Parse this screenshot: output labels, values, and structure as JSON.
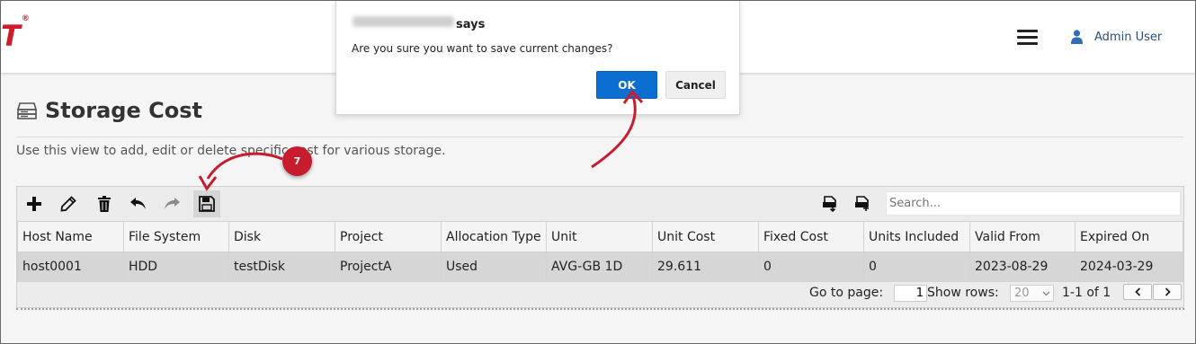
{
  "header": {
    "logo_text": "T",
    "logo_mark": "®",
    "menu_icon": "hamburger-icon",
    "user_icon": "user-icon",
    "user_name": "Admin User"
  },
  "page": {
    "title": "Storage Cost",
    "title_icon": "storage-server-icon",
    "description": "Use this view to add, edit or delete specific cost for various storage."
  },
  "toolbar": {
    "buttons": [
      "add-icon",
      "edit-pencil-icon",
      "delete-trash-icon",
      "undo-icon",
      "redo-icon",
      "save-icon"
    ],
    "export_buttons": [
      "export-pdf-icon",
      "export-all-pdf-icon"
    ],
    "search_placeholder": "Search..."
  },
  "table": {
    "columns": [
      "Host Name",
      "File System",
      "Disk",
      "Project",
      "Allocation Type",
      "Unit",
      "Unit Cost",
      "Fixed Cost",
      "Units Included",
      "Valid From",
      "Expired On"
    ],
    "rows": [
      [
        "host0001",
        "HDD",
        "testDisk",
        "ProjectA",
        "Used",
        "AVG-GB 1D",
        "29.611",
        "0",
        "0",
        "2023-08-29",
        "2024-03-29"
      ]
    ]
  },
  "pager": {
    "goto_label": "Go to page:",
    "page_value": "1",
    "show_rows_label": "Show rows:",
    "rows_value": "20",
    "range_text": "1-1 of 1",
    "prev_icon": "chevron-left-icon",
    "next_icon": "chevron-right-icon"
  },
  "dialog": {
    "title_suffix": "says",
    "message": "Are you sure you want to save current changes?",
    "ok_label": "OK",
    "cancel_label": "Cancel"
  },
  "annotation": {
    "step_number": "7",
    "color": "#c71c2e"
  },
  "colors": {
    "accent_blue": "#0b6fd1",
    "brand_red": "#d11a2a",
    "user_blue": "#2a4e7a"
  }
}
